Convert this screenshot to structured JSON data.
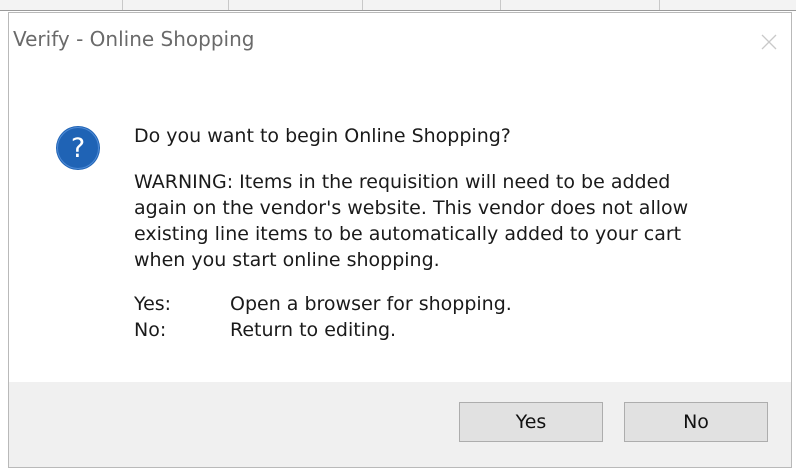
{
  "dialog": {
    "title": "Verify - Online Shopping",
    "question": "Do you want to begin Online Shopping?",
    "warning_lines": [
      "WARNING:  Items in the requisition will need to be added",
      "again on the vendor's website. This vendor does not allow",
      "existing line items to be automatically added to your cart",
      "when you start online shopping."
    ],
    "options": [
      {
        "key": "Yes:",
        "desc": "Open a browser for shopping."
      },
      {
        "key": "No:",
        "desc": "Return to editing."
      }
    ],
    "buttons": {
      "yes_label": "Yes",
      "no_label": "No"
    },
    "icon": "question-icon"
  },
  "colors": {
    "icon_blue": "#1f63b5",
    "footer_bg": "#f0f0f0",
    "button_bg": "#e1e1e1",
    "button_border": "#adadad",
    "title_text": "#6a6a6a"
  }
}
